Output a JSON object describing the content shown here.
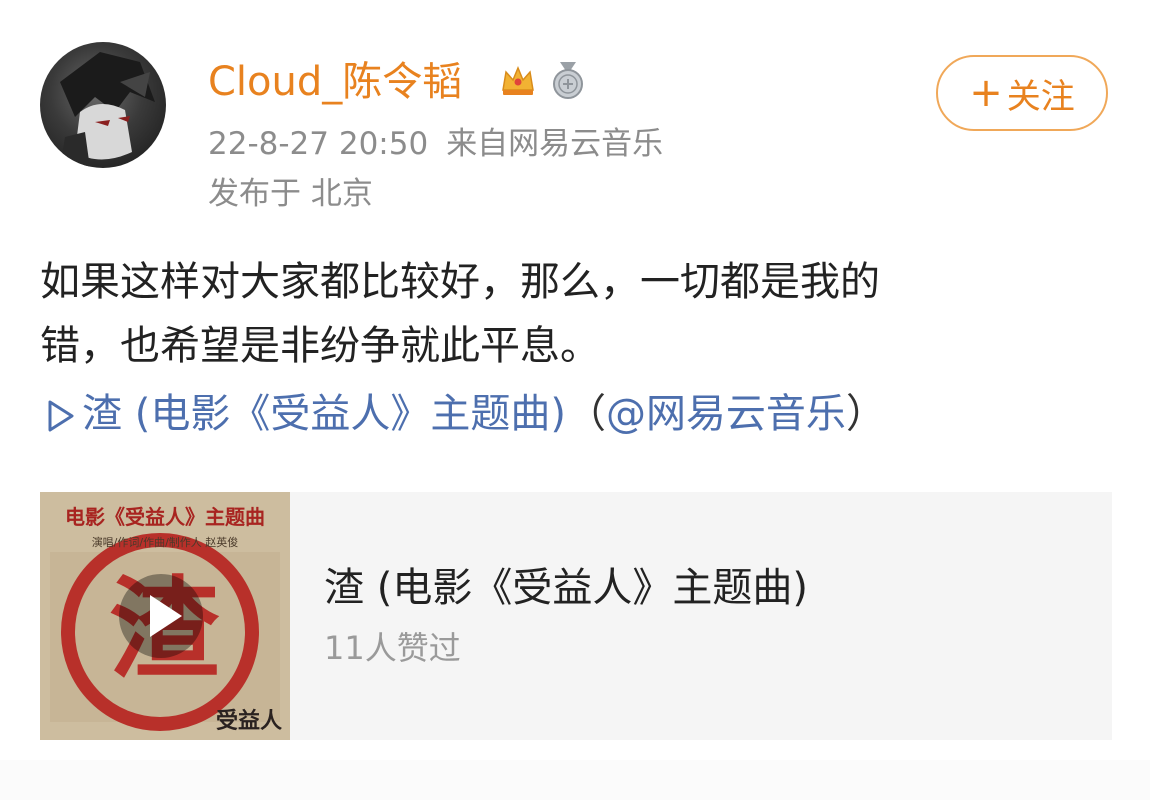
{
  "post": {
    "author": {
      "name": "Cloud_陈令韬",
      "avatar_icon": "avatar-anime-character"
    },
    "badges": [
      "crown-icon",
      "medal-icon"
    ],
    "timestamp": "22-8-27 20:50",
    "source": "来自网易云音乐",
    "location": "发布于 北京",
    "follow_label": "关注",
    "text_lines": [
      "如果这样对大家都比较好，那么，一切都是我的",
      "错，也希望是非纷争就此平息。"
    ],
    "music_link": {
      "label": "渣 (电影《受益人》主题曲)",
      "open_paren": "（",
      "mention": "@网易云音乐",
      "close_paren": "）"
    },
    "music_card": {
      "title": "渣 (电影《受益人》主题曲)",
      "likes": "11人赞过",
      "cover": {
        "header": "电影《受益人》主题曲",
        "credits": "演唱/作词/作曲/制作人  赵英俊",
        "big_char": "渣",
        "corner_text": "受益人"
      }
    }
  },
  "colors": {
    "username": "#e8821f",
    "link": "#4d6fae",
    "meta": "#8c8c8c",
    "card_bg": "#f5f5f5"
  }
}
